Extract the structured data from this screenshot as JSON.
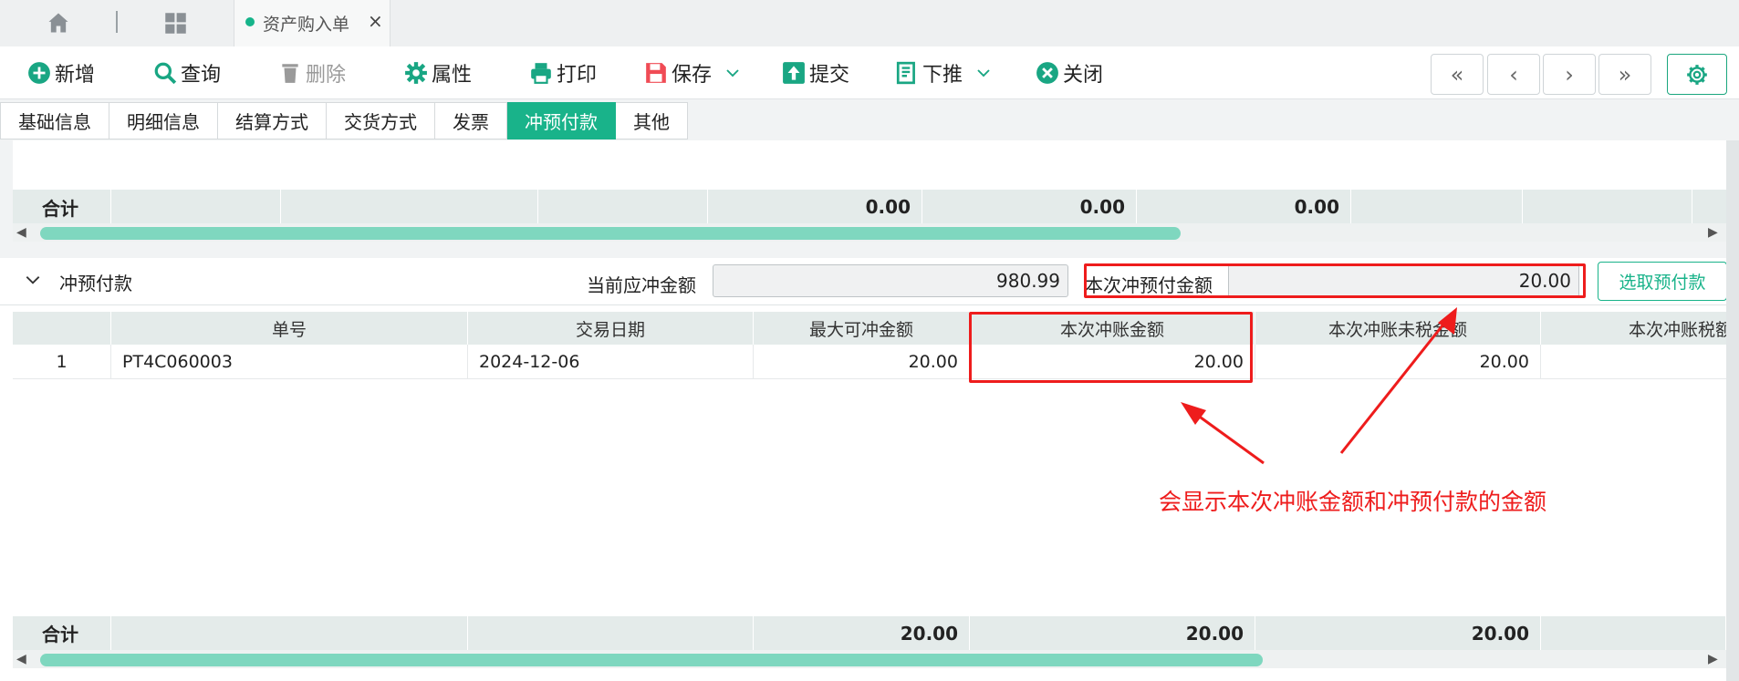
{
  "app_tab": {
    "title": "资产购入单",
    "close_glyph": "×"
  },
  "toolbar": {
    "new": "新增",
    "query": "查询",
    "delete": "删除",
    "props": "属性",
    "print": "打印",
    "save": "保存",
    "submit": "提交",
    "push": "下推",
    "close": "关闭",
    "nav_first": "«",
    "nav_prev": "‹",
    "nav_next": "›",
    "nav_last": "»"
  },
  "section_tabs": [
    "基础信息",
    "明细信息",
    "结算方式",
    "交货方式",
    "发票",
    "冲预付款",
    "其他"
  ],
  "active_tab": "冲预付款",
  "top_summary": {
    "label": "合计",
    "values": [
      "0.00",
      "0.00",
      "0.00"
    ]
  },
  "offset_section": {
    "title": "冲预付款",
    "current_due_label": "当前应冲金额",
    "current_due_value": "980.99",
    "this_offset_label": "本次冲预付金额",
    "this_offset_value": "20.00",
    "select_button": "选取预付款"
  },
  "grid": {
    "columns": [
      "单号",
      "交易日期",
      "最大可冲金额",
      "本次冲账金额",
      "本次冲账未税金额",
      "本次冲账税额"
    ],
    "rows": [
      {
        "idx": "1",
        "doc_no": "PT4C060003",
        "date": "2024-12-06",
        "max": "20.00",
        "amount": "20.00",
        "net": "20.00",
        "tax": ""
      }
    ],
    "summary": {
      "label": "合计",
      "max": "20.00",
      "amount": "20.00",
      "net": "20.00"
    }
  },
  "annotation": "会显示本次冲账金额和冲预付款的金额",
  "colors": {
    "accent": "#19b38a",
    "annotation": "#ee1c1c"
  },
  "icons": [
    "home-icon",
    "grid-icon",
    "plus-circle-icon",
    "search-icon",
    "trash-icon",
    "gear-icon",
    "printer-icon",
    "save-icon",
    "upload-icon",
    "push-down-icon",
    "close-circle-icon",
    "chevron-down-icon",
    "settings-icon"
  ]
}
